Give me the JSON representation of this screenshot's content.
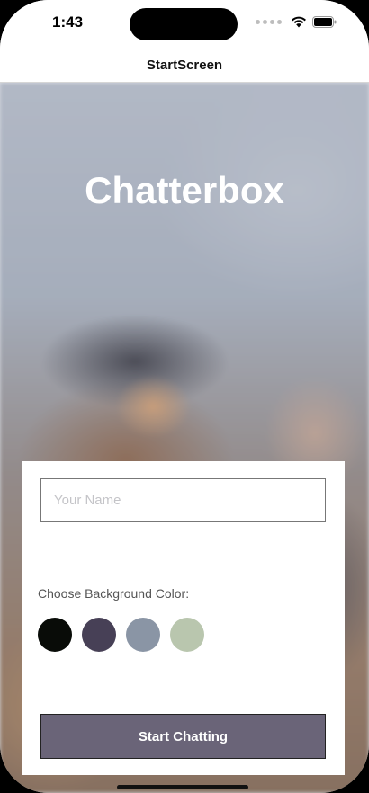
{
  "status_bar": {
    "time": "1:43",
    "icons": [
      "cellular-signal-icon",
      "wifi-icon",
      "battery-icon"
    ]
  },
  "nav": {
    "title": "StartScreen"
  },
  "hero": {
    "app_title": "Chatterbox"
  },
  "form": {
    "name_placeholder": "Your Name",
    "name_value": "",
    "color_label": "Choose Background Color:",
    "colors": [
      {
        "name": "black",
        "hex": "#090C08"
      },
      {
        "name": "dark-purple",
        "hex": "#474056"
      },
      {
        "name": "slate-gray",
        "hex": "#8A95A5"
      },
      {
        "name": "sage-green",
        "hex": "#B9C6AE"
      }
    ],
    "start_label": "Start Chatting"
  },
  "theme": {
    "button_color": "#6A6478",
    "card_background": "#FFFFFF"
  }
}
